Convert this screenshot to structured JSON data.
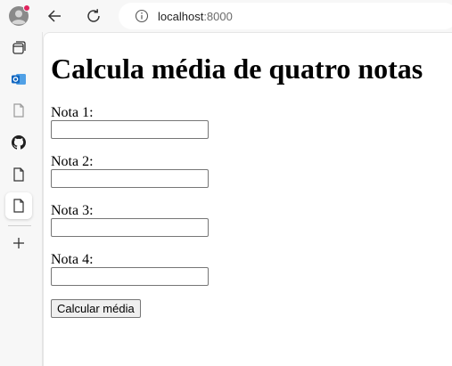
{
  "browser": {
    "address": {
      "host": "localhost",
      "port": ":8000"
    },
    "sidebar_icons": [
      "profile-avatar",
      "tab-actions",
      "outlook",
      "document",
      "github",
      "document",
      "document-active",
      "new-tab-plus"
    ]
  },
  "page": {
    "title": "Calcula média de quatro notas",
    "fields": [
      {
        "label": "Nota 1:",
        "value": ""
      },
      {
        "label": "Nota 2:",
        "value": ""
      },
      {
        "label": "Nota 3:",
        "value": ""
      },
      {
        "label": "Nota 4:",
        "value": ""
      }
    ],
    "button_label": "Calcular média"
  },
  "colors": {
    "accent": "#0078d4",
    "notification": "#e0245e"
  }
}
